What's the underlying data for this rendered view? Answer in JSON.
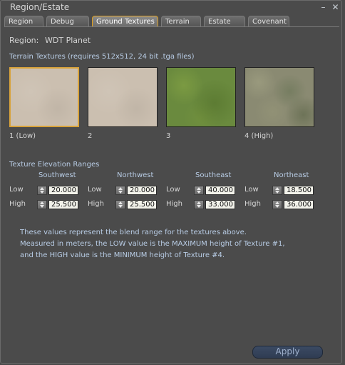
{
  "window": {
    "title": "Region/Estate"
  },
  "tabs": [
    {
      "label": "Region"
    },
    {
      "label": "Debug"
    },
    {
      "label": "Ground Textures"
    },
    {
      "label": "Terrain"
    },
    {
      "label": "Estate"
    },
    {
      "label": "Covenant"
    }
  ],
  "region": {
    "label": "Region:",
    "name": "WDT Planet"
  },
  "textures": {
    "heading": "Terrain Textures (requires 512x512, 24 bit .tga files)",
    "items": [
      {
        "label": "1 (Low)"
      },
      {
        "label": "2"
      },
      {
        "label": "3"
      },
      {
        "label": "4 (High)"
      }
    ]
  },
  "ranges": {
    "heading": "Texture Elevation Ranges",
    "low_label": "Low",
    "high_label": "High",
    "corners": [
      {
        "name": "Southwest",
        "low": "20.000",
        "high": "25.500"
      },
      {
        "name": "Northwest",
        "low": "20.000",
        "high": "25.500"
      },
      {
        "name": "Southeast",
        "low": "40.000",
        "high": "33.000"
      },
      {
        "name": "Northeast",
        "low": "18.500",
        "high": "36.000"
      }
    ]
  },
  "help": {
    "line1": "These values represent the blend range for the textures above.",
    "line2": "Measured in meters, the LOW value is the MAXIMUM height of Texture #1,",
    "line3": "and the HIGH value is the MINIMUM height of Texture #4."
  },
  "apply_label": "Apply",
  "colors": {
    "selected_border": "#d9a33a",
    "active_tab_border": "#e0a020",
    "help_text": "#b9cde6"
  }
}
